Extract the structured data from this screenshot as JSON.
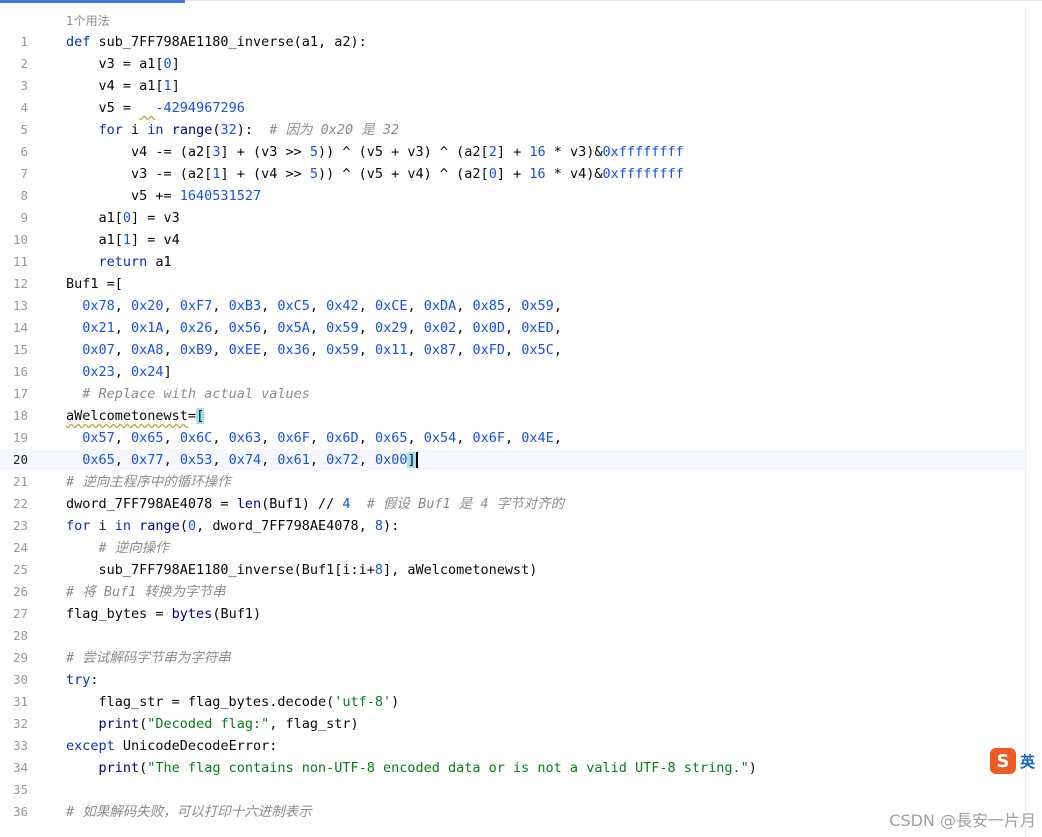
{
  "editor": {
    "usage_hint": "1个用法",
    "current_line": 20
  },
  "lines": [
    {
      "n": "1",
      "tokens": [
        [
          "kw",
          "def "
        ],
        [
          "fn",
          "sub_7FF798AE1180_inverse"
        ],
        [
          "p",
          "(a1, a2):"
        ]
      ]
    },
    {
      "n": "2",
      "tokens": [
        [
          "p",
          "    v3 = a1["
        ],
        [
          "num",
          "0"
        ],
        [
          "p",
          "]"
        ]
      ]
    },
    {
      "n": "3",
      "tokens": [
        [
          "p",
          "    v4 = a1["
        ],
        [
          "num",
          "1"
        ],
        [
          "p",
          "]"
        ]
      ]
    },
    {
      "n": "4",
      "tokens": [
        [
          "p",
          "    v5 = "
        ],
        [
          "warn",
          "  "
        ],
        [
          "num",
          "-4294967296"
        ]
      ]
    },
    {
      "n": "5",
      "tokens": [
        [
          "kw",
          "    for "
        ],
        [
          "p",
          "i "
        ],
        [
          "kw",
          "in "
        ],
        [
          "builtin",
          "range"
        ],
        [
          "p",
          "("
        ],
        [
          "num",
          "32"
        ],
        [
          "p",
          "):  "
        ],
        [
          "cmt",
          "# 因为 0x20 是 32"
        ]
      ]
    },
    {
      "n": "6",
      "tokens": [
        [
          "p",
          "        v4 -= (a2["
        ],
        [
          "num",
          "3"
        ],
        [
          "p",
          "] + (v3 >> "
        ],
        [
          "num",
          "5"
        ],
        [
          "p",
          ")) ^ (v5 + v3) ^ (a2["
        ],
        [
          "num",
          "2"
        ],
        [
          "p",
          "] + "
        ],
        [
          "num",
          "16"
        ],
        [
          "p",
          " * v3)&"
        ],
        [
          "num",
          "0xffffffff"
        ]
      ]
    },
    {
      "n": "7",
      "tokens": [
        [
          "p",
          "        v3 -= (a2["
        ],
        [
          "num",
          "1"
        ],
        [
          "p",
          "] + (v4 >> "
        ],
        [
          "num",
          "5"
        ],
        [
          "p",
          ")) ^ (v5 + v4) ^ (a2["
        ],
        [
          "num",
          "0"
        ],
        [
          "p",
          "] + "
        ],
        [
          "num",
          "16"
        ],
        [
          "p",
          " * v4)&"
        ],
        [
          "num",
          "0xffffffff"
        ]
      ]
    },
    {
      "n": "8",
      "tokens": [
        [
          "p",
          "        v5 += "
        ],
        [
          "num",
          "1640531527"
        ]
      ]
    },
    {
      "n": "9",
      "tokens": [
        [
          "p",
          "    a1["
        ],
        [
          "num",
          "0"
        ],
        [
          "p",
          "] = v3"
        ]
      ]
    },
    {
      "n": "10",
      "tokens": [
        [
          "p",
          "    a1["
        ],
        [
          "num",
          "1"
        ],
        [
          "p",
          "] = v4"
        ]
      ]
    },
    {
      "n": "11",
      "tokens": [
        [
          "kw",
          "    return "
        ],
        [
          "p",
          "a1"
        ]
      ]
    },
    {
      "n": "12",
      "tokens": [
        [
          "p",
          "Buf1 =["
        ]
      ]
    },
    {
      "n": "13",
      "tokens": [
        [
          "p",
          "  "
        ],
        [
          "num",
          "0x78"
        ],
        [
          "p",
          ", "
        ],
        [
          "num",
          "0x20"
        ],
        [
          "p",
          ", "
        ],
        [
          "num",
          "0xF7"
        ],
        [
          "p",
          ", "
        ],
        [
          "num",
          "0xB3"
        ],
        [
          "p",
          ", "
        ],
        [
          "num",
          "0xC5"
        ],
        [
          "p",
          ", "
        ],
        [
          "num",
          "0x42"
        ],
        [
          "p",
          ", "
        ],
        [
          "num",
          "0xCE"
        ],
        [
          "p",
          ", "
        ],
        [
          "num",
          "0xDA"
        ],
        [
          "p",
          ", "
        ],
        [
          "num",
          "0x85"
        ],
        [
          "p",
          ", "
        ],
        [
          "num",
          "0x59"
        ],
        [
          "p",
          ","
        ]
      ]
    },
    {
      "n": "14",
      "tokens": [
        [
          "p",
          "  "
        ],
        [
          "num",
          "0x21"
        ],
        [
          "p",
          ", "
        ],
        [
          "num",
          "0x1A"
        ],
        [
          "p",
          ", "
        ],
        [
          "num",
          "0x26"
        ],
        [
          "p",
          ", "
        ],
        [
          "num",
          "0x56"
        ],
        [
          "p",
          ", "
        ],
        [
          "num",
          "0x5A"
        ],
        [
          "p",
          ", "
        ],
        [
          "num",
          "0x59"
        ],
        [
          "p",
          ", "
        ],
        [
          "num",
          "0x29"
        ],
        [
          "p",
          ", "
        ],
        [
          "num",
          "0x02"
        ],
        [
          "p",
          ", "
        ],
        [
          "num",
          "0x0D"
        ],
        [
          "p",
          ", "
        ],
        [
          "num",
          "0xED"
        ],
        [
          "p",
          ","
        ]
      ]
    },
    {
      "n": "15",
      "tokens": [
        [
          "p",
          "  "
        ],
        [
          "num",
          "0x07"
        ],
        [
          "p",
          ", "
        ],
        [
          "num",
          "0xA8"
        ],
        [
          "p",
          ", "
        ],
        [
          "num",
          "0xB9"
        ],
        [
          "p",
          ", "
        ],
        [
          "num",
          "0xEE"
        ],
        [
          "p",
          ", "
        ],
        [
          "num",
          "0x36"
        ],
        [
          "p",
          ", "
        ],
        [
          "num",
          "0x59"
        ],
        [
          "p",
          ", "
        ],
        [
          "num",
          "0x11"
        ],
        [
          "p",
          ", "
        ],
        [
          "num",
          "0x87"
        ],
        [
          "p",
          ", "
        ],
        [
          "num",
          "0xFD"
        ],
        [
          "p",
          ", "
        ],
        [
          "num",
          "0x5C"
        ],
        [
          "p",
          ","
        ]
      ]
    },
    {
      "n": "16",
      "tokens": [
        [
          "p",
          "  "
        ],
        [
          "num",
          "0x23"
        ],
        [
          "p",
          ", "
        ],
        [
          "num",
          "0x24"
        ],
        [
          "p",
          "]"
        ]
      ]
    },
    {
      "n": "17",
      "tokens": [
        [
          "p",
          "  "
        ],
        [
          "cmt",
          "# Replace with actual values"
        ]
      ]
    },
    {
      "n": "18",
      "tokens": [
        [
          "warn",
          "aWelcometonewst"
        ],
        [
          "p",
          "="
        ],
        [
          "brace",
          "["
        ]
      ]
    },
    {
      "n": "19",
      "tokens": [
        [
          "p",
          "  "
        ],
        [
          "num",
          "0x57"
        ],
        [
          "p",
          ", "
        ],
        [
          "num",
          "0x65"
        ],
        [
          "p",
          ", "
        ],
        [
          "num",
          "0x6C"
        ],
        [
          "p",
          ", "
        ],
        [
          "num",
          "0x63"
        ],
        [
          "p",
          ", "
        ],
        [
          "num",
          "0x6F"
        ],
        [
          "p",
          ", "
        ],
        [
          "num",
          "0x6D"
        ],
        [
          "p",
          ", "
        ],
        [
          "num",
          "0x65"
        ],
        [
          "p",
          ", "
        ],
        [
          "num",
          "0x54"
        ],
        [
          "p",
          ", "
        ],
        [
          "num",
          "0x6F"
        ],
        [
          "p",
          ", "
        ],
        [
          "num",
          "0x4E"
        ],
        [
          "p",
          ","
        ]
      ]
    },
    {
      "n": "20",
      "tokens": [
        [
          "p",
          "  "
        ],
        [
          "num",
          "0x65"
        ],
        [
          "p",
          ", "
        ],
        [
          "num",
          "0x77"
        ],
        [
          "p",
          ", "
        ],
        [
          "num",
          "0x53"
        ],
        [
          "p",
          ", "
        ],
        [
          "num",
          "0x74"
        ],
        [
          "p",
          ", "
        ],
        [
          "num",
          "0x61"
        ],
        [
          "p",
          ", "
        ],
        [
          "num",
          "0x72"
        ],
        [
          "p",
          ", "
        ],
        [
          "num",
          "0x00"
        ],
        [
          "brace",
          "]"
        ]
      ]
    },
    {
      "n": "21",
      "tokens": [
        [
          "cmt",
          "# 逆向主程序中的循环操作"
        ]
      ]
    },
    {
      "n": "22",
      "tokens": [
        [
          "p",
          "dword_7FF798AE4078 = "
        ],
        [
          "builtin",
          "len"
        ],
        [
          "p",
          "(Buf1) // "
        ],
        [
          "num",
          "4"
        ],
        [
          "p",
          "  "
        ],
        [
          "cmt",
          "# 假设 Buf1 是 4 字节对齐的"
        ]
      ]
    },
    {
      "n": "23",
      "tokens": [
        [
          "kw",
          "for "
        ],
        [
          "p",
          "i "
        ],
        [
          "kw",
          "in "
        ],
        [
          "builtin",
          "range"
        ],
        [
          "p",
          "("
        ],
        [
          "num",
          "0"
        ],
        [
          "p",
          ", dword_7FF798AE4078, "
        ],
        [
          "num",
          "8"
        ],
        [
          "p",
          "):"
        ]
      ]
    },
    {
      "n": "24",
      "tokens": [
        [
          "p",
          "    "
        ],
        [
          "cmt",
          "# 逆向操作"
        ]
      ]
    },
    {
      "n": "25",
      "tokens": [
        [
          "p",
          "    sub_7FF798AE1180_inverse(Buf1[i:i+"
        ],
        [
          "num",
          "8"
        ],
        [
          "p",
          "], aWelcometonewst)"
        ]
      ]
    },
    {
      "n": "26",
      "tokens": [
        [
          "cmt",
          "# 将 Buf1 转换为字节串"
        ]
      ]
    },
    {
      "n": "27",
      "tokens": [
        [
          "p",
          "flag_bytes = "
        ],
        [
          "builtin",
          "bytes"
        ],
        [
          "p",
          "(Buf1)"
        ]
      ]
    },
    {
      "n": "28",
      "tokens": []
    },
    {
      "n": "29",
      "tokens": [
        [
          "cmt",
          "# 尝试解码字节串为字符串"
        ]
      ]
    },
    {
      "n": "30",
      "tokens": [
        [
          "kw",
          "try"
        ],
        [
          "p",
          ":"
        ]
      ]
    },
    {
      "n": "31",
      "tokens": [
        [
          "p",
          "    flag_str = flag_bytes.decode("
        ],
        [
          "str",
          "'utf-8'"
        ],
        [
          "p",
          ")"
        ]
      ]
    },
    {
      "n": "32",
      "tokens": [
        [
          "p",
          "    "
        ],
        [
          "builtin",
          "print"
        ],
        [
          "p",
          "("
        ],
        [
          "str",
          "\"Decoded flag:\""
        ],
        [
          "p",
          ", flag_str)"
        ]
      ]
    },
    {
      "n": "33",
      "tokens": [
        [
          "kw",
          "except "
        ],
        [
          "p",
          "UnicodeDecodeError:"
        ]
      ]
    },
    {
      "n": "34",
      "tokens": [
        [
          "p",
          "    "
        ],
        [
          "builtin",
          "print"
        ],
        [
          "p",
          "("
        ],
        [
          "str",
          "\"The flag contains non-UTF-8 encoded data or is not a valid UTF-8 string.\""
        ],
        [
          "p",
          ")"
        ]
      ]
    },
    {
      "n": "35",
      "tokens": []
    },
    {
      "n": "36",
      "tokens": [
        [
          "cmt",
          "# 如果解码失败，可以打印十六进制表示"
        ]
      ]
    }
  ],
  "overlay": {
    "ime_logo": "S",
    "ime_label": "英",
    "watermark": "CSDN @長安一片月"
  }
}
